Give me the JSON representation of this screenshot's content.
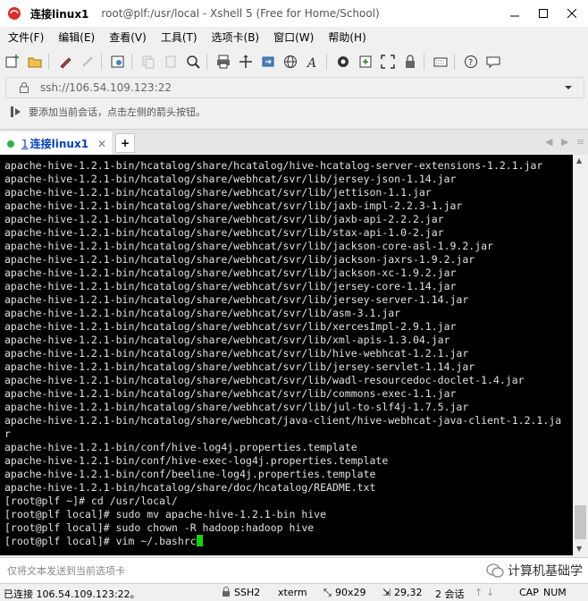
{
  "window": {
    "tab_short_title": "连接linux1",
    "full_title": "root@plf:/usr/local - Xshell 5 (Free for Home/School)"
  },
  "menu": [
    "文件(F)",
    "编辑(E)",
    "查看(V)",
    "工具(T)",
    "选项卡(B)",
    "窗口(W)",
    "帮助(H)"
  ],
  "address": {
    "value": "ssh://106.54.109.123:22"
  },
  "hint": "要添加当前会话，点击左侧的箭头按钮。",
  "tabs": [
    {
      "number": "1",
      "label": "连接linux1",
      "status_color": "#2bb34b"
    }
  ],
  "terminal": {
    "lines": [
      "apache-hive-1.2.1-bin/hcatalog/share/hcatalog/hive-hcatalog-server-extensions-1.2.1.jar",
      "apache-hive-1.2.1-bin/hcatalog/share/webhcat/svr/lib/jersey-json-1.14.jar",
      "apache-hive-1.2.1-bin/hcatalog/share/webhcat/svr/lib/jettison-1.1.jar",
      "apache-hive-1.2.1-bin/hcatalog/share/webhcat/svr/lib/jaxb-impl-2.2.3-1.jar",
      "apache-hive-1.2.1-bin/hcatalog/share/webhcat/svr/lib/jaxb-api-2.2.2.jar",
      "apache-hive-1.2.1-bin/hcatalog/share/webhcat/svr/lib/stax-api-1.0-2.jar",
      "apache-hive-1.2.1-bin/hcatalog/share/webhcat/svr/lib/jackson-core-asl-1.9.2.jar",
      "apache-hive-1.2.1-bin/hcatalog/share/webhcat/svr/lib/jackson-jaxrs-1.9.2.jar",
      "apache-hive-1.2.1-bin/hcatalog/share/webhcat/svr/lib/jackson-xc-1.9.2.jar",
      "apache-hive-1.2.1-bin/hcatalog/share/webhcat/svr/lib/jersey-core-1.14.jar",
      "apache-hive-1.2.1-bin/hcatalog/share/webhcat/svr/lib/jersey-server-1.14.jar",
      "apache-hive-1.2.1-bin/hcatalog/share/webhcat/svr/lib/asm-3.1.jar",
      "apache-hive-1.2.1-bin/hcatalog/share/webhcat/svr/lib/xercesImpl-2.9.1.jar",
      "apache-hive-1.2.1-bin/hcatalog/share/webhcat/svr/lib/xml-apis-1.3.04.jar",
      "apache-hive-1.2.1-bin/hcatalog/share/webhcat/svr/lib/hive-webhcat-1.2.1.jar",
      "apache-hive-1.2.1-bin/hcatalog/share/webhcat/svr/lib/jersey-servlet-1.14.jar",
      "apache-hive-1.2.1-bin/hcatalog/share/webhcat/svr/lib/wadl-resourcedoc-doclet-1.4.jar",
      "apache-hive-1.2.1-bin/hcatalog/share/webhcat/svr/lib/commons-exec-1.1.jar",
      "apache-hive-1.2.1-bin/hcatalog/share/webhcat/svr/lib/jul-to-slf4j-1.7.5.jar",
      "apache-hive-1.2.1-bin/hcatalog/share/webhcat/java-client/hive-webhcat-java-client-1.2.1.ja",
      "r",
      "apache-hive-1.2.1-bin/conf/hive-log4j.properties.template",
      "apache-hive-1.2.1-bin/conf/hive-exec-log4j.properties.template",
      "apache-hive-1.2.1-bin/conf/beeline-log4j.properties.template",
      "apache-hive-1.2.1-bin/hcatalog/share/doc/hcatalog/README.txt",
      "[root@plf ~]# cd /usr/local/",
      "[root@plf local]# sudo mv apache-hive-1.2.1-bin hive",
      "[root@plf local]# sudo chown -R hadoop:hadoop hive"
    ],
    "current_prompt": "[root@plf local]# vim ~/.bashrc"
  },
  "input_bar": {
    "placeholder": "仅将文本发送到当前选项卡"
  },
  "watermark": "计算机基础学",
  "status": {
    "connection": "已连接 106.54.109.123:22。",
    "protocol": "SSH2",
    "terminal_type": "xterm",
    "size": "90x29",
    "cursor_pos": "29,32",
    "sessions": "2 会话",
    "caps": "CAP",
    "num": "NUM"
  }
}
